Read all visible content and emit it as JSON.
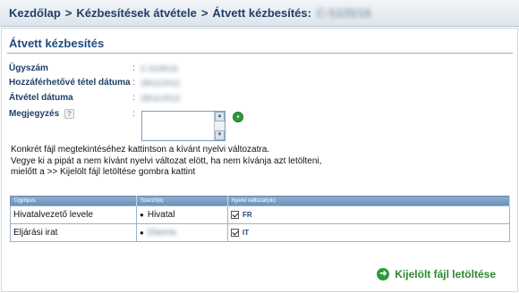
{
  "breadcrumb": {
    "items": [
      "Kezdőlap",
      "Kézbesítések átvétele",
      "Átvett kézbesítés:"
    ],
    "separator": ">",
    "redacted_value": "C-5105/16"
  },
  "page": {
    "title": "Átvett kézbesítés"
  },
  "fields": {
    "case_number": {
      "label": "Ügyszám",
      "value": "C-5105/16"
    },
    "available_date": {
      "label": "Hozzáférhetővé tétel dátuma",
      "value": "28/11/2012"
    },
    "received_date": {
      "label": "Átvétel dátuma",
      "value": "28/11/2012"
    },
    "comment": {
      "label": "Megjegyzés",
      "help": "?",
      "value": ""
    },
    "colon": ":"
  },
  "instructions": {
    "line1": "Konkrét fájl megtekintéséhez kattintson a kívánt nyelvi változatra.",
    "line2": "Vegye ki a pipát a nem kívánt nyelvi változat elött, ha nem kívánja azt letölteni,",
    "line3": "mielőtt a  >> Kijelölt fájl letöltése gombra kattint"
  },
  "table": {
    "headers": [
      "Ügytípus",
      "Szerző(k)",
      "Nyelvi változat(ok)"
    ],
    "rows": [
      {
        "type": "Hivatalvezető levele",
        "author": "Hivatal",
        "lang": "FR",
        "checked": true
      },
      {
        "type": "Eljárási irat",
        "author": "Dianna",
        "lang": "IT",
        "checked": true
      }
    ]
  },
  "actions": {
    "download_label": "Kijelölt fájl letöltése"
  },
  "colors": {
    "title_blue": "#1f4a80",
    "header_blue": "#6a8fb8",
    "accent_green": "#2b8a2f"
  }
}
